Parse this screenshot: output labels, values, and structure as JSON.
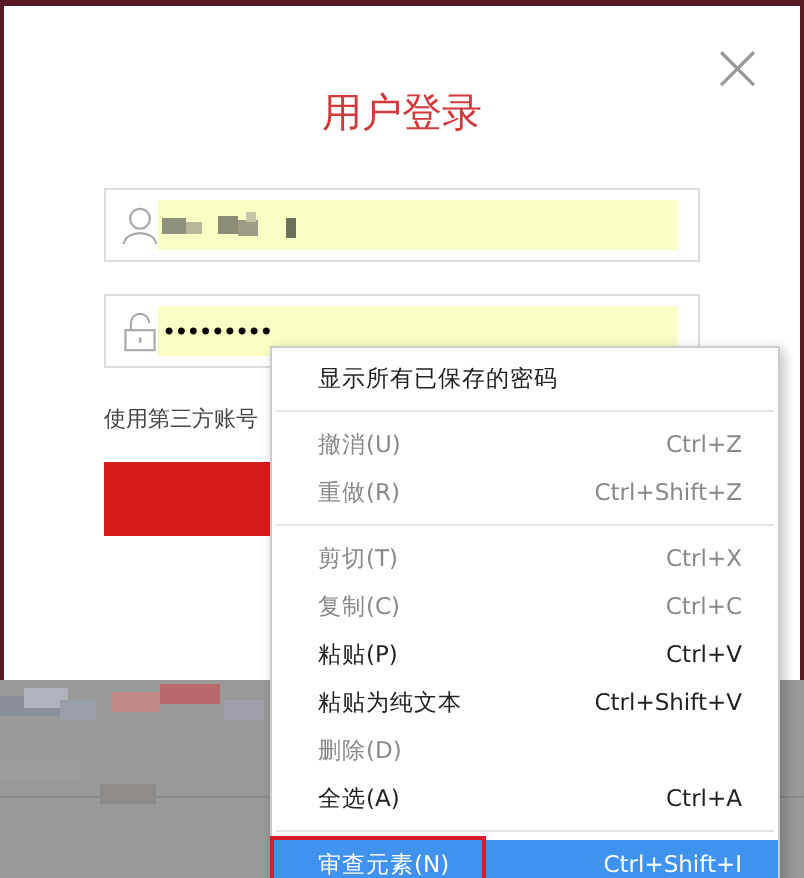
{
  "dialog": {
    "title": "用户登录",
    "close_glyph": "×",
    "password_field": {
      "value": "•••••••••"
    },
    "third_party_label": "使用第三方账号"
  },
  "context_menu": {
    "items": [
      {
        "kind": "item",
        "label": "显示所有已保存的密码",
        "disabled": false,
        "selected": false
      },
      {
        "kind": "separator"
      },
      {
        "kind": "item",
        "label": "撤消(U)",
        "shortcut": "Ctrl+Z",
        "disabled": true,
        "selected": false
      },
      {
        "kind": "item",
        "label": "重做(R)",
        "shortcut": "Ctrl+Shift+Z",
        "disabled": true,
        "selected": false
      },
      {
        "kind": "separator"
      },
      {
        "kind": "item",
        "label": "剪切(T)",
        "shortcut": "Ctrl+X",
        "disabled": true,
        "selected": false
      },
      {
        "kind": "item",
        "label": "复制(C)",
        "shortcut": "Ctrl+C",
        "disabled": true,
        "selected": false
      },
      {
        "kind": "item",
        "label": "粘贴(P)",
        "shortcut": "Ctrl+V",
        "disabled": false,
        "selected": false
      },
      {
        "kind": "item",
        "label": "粘贴为纯文本",
        "shortcut": "Ctrl+Shift+V",
        "disabled": false,
        "selected": false
      },
      {
        "kind": "item",
        "label": "删除(D)",
        "disabled": true,
        "selected": false
      },
      {
        "kind": "item",
        "label": "全选(A)",
        "shortcut": "Ctrl+A",
        "disabled": false,
        "selected": false
      },
      {
        "kind": "separator"
      },
      {
        "kind": "item",
        "label": "审查元素(N)",
        "shortcut": "Ctrl+Shift+I",
        "disabled": false,
        "selected": true
      }
    ]
  }
}
